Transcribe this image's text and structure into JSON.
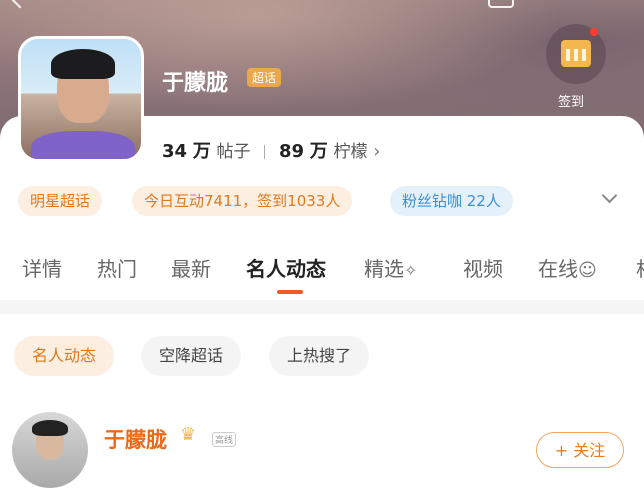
{
  "profile": {
    "name": "于朦胧",
    "badge": "超话",
    "checkin_label": "签到",
    "posts_count": "34",
    "posts_unit": "万",
    "posts_label": "帖子",
    "fans_count": "89",
    "fans_unit": "万",
    "fans_label": "柠檬",
    "chevron": "›"
  },
  "tags": [
    {
      "label": "明星超话"
    },
    {
      "label": "今日互动7411，签到1033人"
    },
    {
      "label": "粉丝钻咖 22人"
    }
  ],
  "tabs": [
    {
      "label": "详情"
    },
    {
      "label": "热门"
    },
    {
      "label": "最新"
    },
    {
      "label": "名人动态"
    },
    {
      "label": "精选"
    },
    {
      "label": "视频"
    },
    {
      "label": "在线"
    }
  ],
  "pills": [
    {
      "label": "名人动态"
    },
    {
      "label": "空降超话"
    },
    {
      "label": "上热搜了"
    }
  ],
  "post": {
    "author": "于朦胧",
    "tiny_tag": "高线",
    "follow_label": "+ 关注"
  },
  "colors": {
    "accent": "#f05a22",
    "orange_text": "#e07a1f",
    "blue_text": "#3a8fd6"
  },
  "icons": [
    "back-icon",
    "share-icon",
    "calendar-icon",
    "chevron-down-icon",
    "sparkle-icon",
    "smile-icon",
    "crown-icon"
  ]
}
